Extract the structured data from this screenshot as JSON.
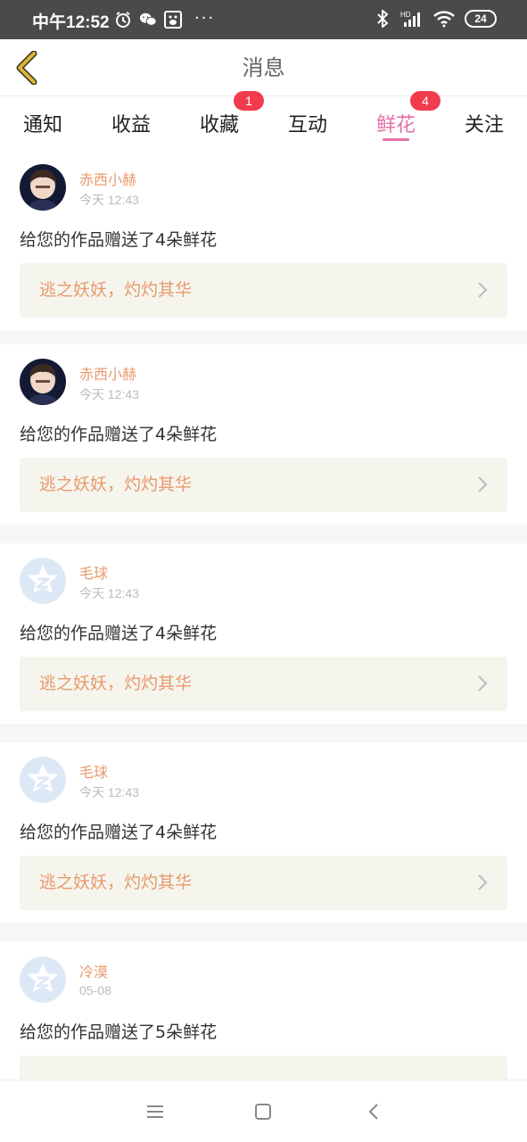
{
  "status_bar": {
    "time": "中午12:52",
    "more": "···",
    "battery": "24",
    "icons": [
      "alarm-icon",
      "wechat-icon",
      "baidu-icon",
      "bluetooth-icon",
      "signal-icon",
      "wifi-icon",
      "battery-icon"
    ]
  },
  "header": {
    "title": "消息",
    "back_icon": "back-chevron-icon"
  },
  "tabs": [
    {
      "label": "通知",
      "badge": ""
    },
    {
      "label": "收益",
      "badge": ""
    },
    {
      "label": "收藏",
      "badge": "1"
    },
    {
      "label": "互动",
      "badge": ""
    },
    {
      "label": "鲜花",
      "badge": "4",
      "active": true
    },
    {
      "label": "关注",
      "badge": ""
    }
  ],
  "messages": [
    {
      "user": "赤西小赫",
      "time": "今天 12:43",
      "text": "给您的作品赠送了4朵鲜花",
      "work": "逃之妖妖，灼灼其华",
      "avatar": "photo-avatar"
    },
    {
      "user": "赤西小赫",
      "time": "今天 12:43",
      "text": "给您的作品赠送了4朵鲜花",
      "work": "逃之妖妖，灼灼其华",
      "avatar": "photo-avatar"
    },
    {
      "user": "毛球",
      "time": "今天 12:43",
      "text": "给您的作品赠送了4朵鲜花",
      "work": "逃之妖妖，灼灼其华",
      "avatar": "default-star-avatar"
    },
    {
      "user": "毛球",
      "time": "今天 12:43",
      "text": "给您的作品赠送了4朵鲜花",
      "work": "逃之妖妖，灼灼其华",
      "avatar": "default-star-avatar"
    },
    {
      "user": "冷漠",
      "time": "05-08",
      "text": "给您的作品赠送了5朵鲜花",
      "work": "",
      "avatar": "default-star-avatar"
    }
  ],
  "colors": {
    "accent": "#e571a8",
    "username": "#e89a6d",
    "badge": "#f33b4e",
    "link_bg": "#f5f5ee",
    "status_bar": "#4a4a4a",
    "back_icon": "#d8b63a"
  },
  "nav": [
    "menu-icon",
    "home-square-icon",
    "back-icon"
  ]
}
